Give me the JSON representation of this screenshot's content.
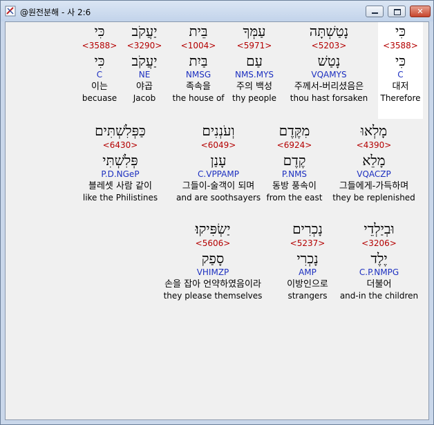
{
  "window": {
    "title": "@원전분해 - 사 2:6",
    "buttons": {
      "minimize": "─",
      "maximize": "□",
      "close": "✕"
    }
  },
  "rows": [
    {
      "words": [
        {
          "hebrew": "כִּי",
          "strong": "<3588>",
          "lemma": "כִּי",
          "parsing": "C",
          "korean": "대저",
          "english": "Therefore",
          "highlighted": true
        },
        {
          "hebrew": "נָטַשְׁתָּה",
          "strong": "<5203>",
          "lemma": "נָטַשׁ",
          "parsing": "VQAMYS",
          "korean": "주께서-버리셨음은",
          "english": "thou hast forsaken"
        },
        {
          "hebrew": "עַמְּךָ",
          "strong": "<5971>",
          "lemma": "עַם",
          "parsing": "NMS.MYS",
          "korean": "주의 백성",
          "english": "thy people"
        },
        {
          "hebrew": "בֵּית",
          "strong": "<1004>",
          "lemma": "בַּיִת",
          "parsing": "NMSG",
          "korean": "족속을",
          "english": "the house of"
        },
        {
          "hebrew": "יַעֲקֹב",
          "strong": "<3290>",
          "lemma": "יַעֲקֹב",
          "parsing": "NE",
          "korean": "야곱",
          "english": "Jacob"
        },
        {
          "hebrew": "כִּי",
          "strong": "<3588>",
          "lemma": "כִּי",
          "parsing": "C",
          "korean": "이는",
          "english": "becuase"
        }
      ]
    },
    {
      "words": [
        {
          "hebrew": "מָלְאוּ",
          "strong": "<4390>",
          "lemma": "מָלֵא",
          "parsing": "VQACZP",
          "korean": "그들에게-가득하며",
          "english": "they be replenished"
        },
        {
          "hebrew": "מִקֶּדֶם",
          "strong": "<6924>",
          "lemma": "קֶדֶם",
          "parsing": "P.NMS",
          "korean": "동방 풍속이",
          "english": "from the east"
        },
        {
          "hebrew": "וְעֹנְנִים",
          "strong": "<6049>",
          "lemma": "עָנַן",
          "parsing": "C.VPPAMP",
          "korean": "그들이-술객이 되며",
          "english": "and are soothsayers"
        },
        {
          "hebrew": "כַּפְּלִשְׁתִּים",
          "strong": "<6430>",
          "lemma": "פְּלִשְׁתִּי",
          "parsing": "P.D.NGeP",
          "korean": "블레셋 사람 같이",
          "english": "like the Philistines"
        }
      ]
    },
    {
      "words": [
        {
          "hebrew": "וּבְיַלְדֵי",
          "strong": "<3206>",
          "lemma": "יֶלֶד",
          "parsing": "C.P.NMPG",
          "korean": "더불어",
          "english": "and-in the children"
        },
        {
          "hebrew": "נָכְרִים",
          "strong": "<5237>",
          "lemma": "נָכְרִי",
          "parsing": "AMP",
          "korean": "이방인으로",
          "english": "strangers"
        },
        {
          "hebrew": "יַשְׂפִּיקוּ׃",
          "strong": "<5606>",
          "lemma": "סָפַק",
          "parsing": "VHIMZP",
          "korean": "손을 잡아 언약하였음이라",
          "english": "they please themselves"
        }
      ]
    }
  ]
}
